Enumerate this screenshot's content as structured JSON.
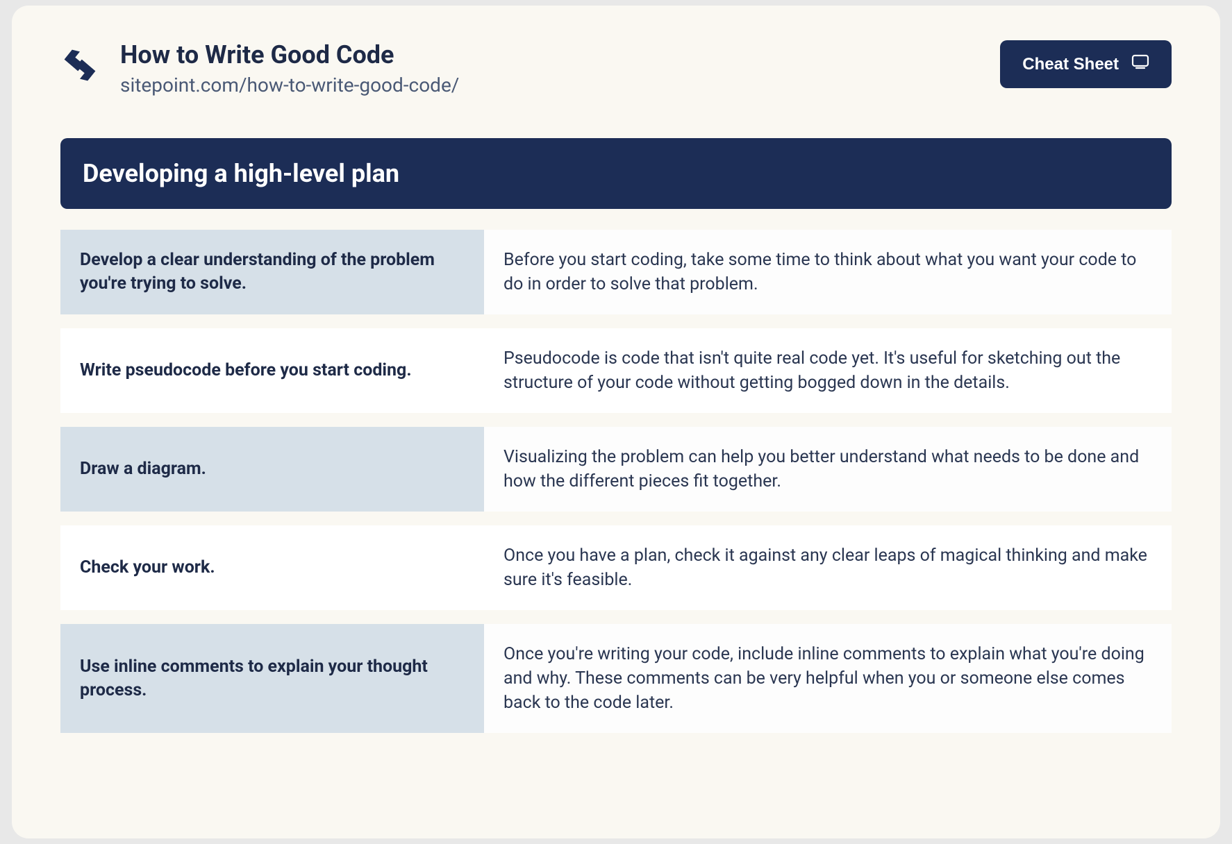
{
  "header": {
    "title": "How to Write Good Code",
    "url": "sitepoint.com/how-to-write-good-code/",
    "button_label": "Cheat Sheet"
  },
  "section": {
    "heading": "Developing a high-level plan"
  },
  "rows": [
    {
      "term": "Develop a clear understanding of the problem you're trying to solve.",
      "desc": "Before you start coding, take some time to think about what you want your code to do in order to solve that problem."
    },
    {
      "term": "Write pseudocode before you start coding.",
      "desc": "Pseudocode is code that isn't quite real code yet. It's useful for sketching out the structure of your code without getting bogged down in the details."
    },
    {
      "term": "Draw a diagram.",
      "desc": "Visualizing the problem can help you better understand what needs to be done and how the different pieces fit together."
    },
    {
      "term": "Check your work.",
      "desc": "Once you have a plan, check it against any clear leaps of magical thinking and make sure it's feasible."
    },
    {
      "term": "Use inline comments to explain your thought process.",
      "desc": "Once you're writing your code, include inline comments to explain what you're doing and why. These comments can be very helpful when you or someone else comes back to the code later."
    }
  ]
}
